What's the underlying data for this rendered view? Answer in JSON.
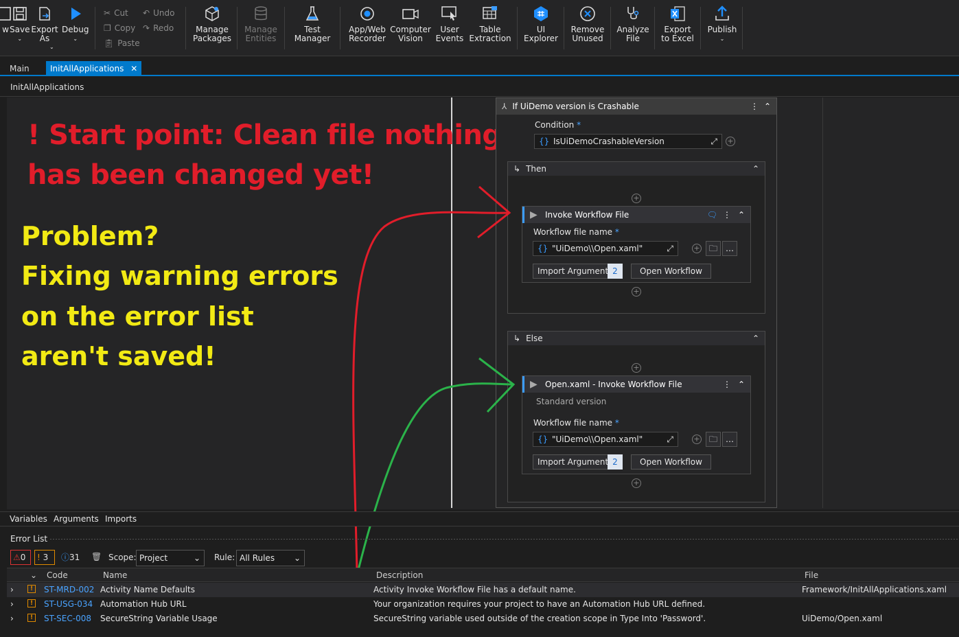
{
  "ribbon": {
    "save_label": "Save",
    "export_as_label": "Export\nAs",
    "debug_label": "Debug",
    "cut_label": "Cut",
    "copy_label": "Copy",
    "paste_label": "Paste",
    "undo_label": "Undo",
    "redo_label": "Redo",
    "manage_packages_label": "Manage\nPackages",
    "manage_entities_label": "Manage\nEntities",
    "test_manager_label": "Test\nManager",
    "app_web_recorder_label": "App/Web\nRecorder",
    "computer_vision_label": "Computer\nVision",
    "user_events_label": "User\nEvents",
    "table_extraction_label": "Table\nExtraction",
    "ui_explorer_label": "UI\nExplorer",
    "remove_unused_label": "Remove\nUnused",
    "analyze_file_label": "Analyze\nFile",
    "export_excel_label": "Export\nto Excel",
    "publish_label": "Publish"
  },
  "tabs": [
    {
      "label": "Main"
    },
    {
      "label": "InitAllApplications"
    }
  ],
  "breadcrumb": "InitAllApplications",
  "annotations": {
    "red_line1": "! Start point: Clean file nothing",
    "red_line2": "has been changed yet!",
    "yellow_line1": "Problem?",
    "yellow_line2": "Fixing warning errors",
    "yellow_line3": "on the error list",
    "yellow_line4": "aren't saved!"
  },
  "if_activity": {
    "title": "If UiDemo version is Crashable",
    "condition_label": "Condition",
    "condition_value": "IsUiDemoCrashableVersion",
    "then_label": "Then",
    "else_label": "Else",
    "then_invoke": {
      "title": "Invoke Workflow File",
      "file_label": "Workflow file name",
      "file_value": "\"UiDemo\\\\Open.xaml\"",
      "import_label": "Import Arguments",
      "import_count": "2",
      "open_label": "Open Workflow"
    },
    "else_invoke": {
      "title": "Open.xaml - Invoke Workflow File",
      "subtitle": "Standard version",
      "file_label": "Workflow file name",
      "file_value": "\"UiDemo\\\\Open.xaml\"",
      "import_label": "Import Arguments",
      "import_count": "2",
      "open_label": "Open Workflow"
    }
  },
  "bottom_tabs": [
    "Variables",
    "Arguments",
    "Imports"
  ],
  "error_list": {
    "title": "Error List",
    "errors_count": "0",
    "warnings_count": "3",
    "info_count": "31",
    "scope_label": "Scope:",
    "scope_value": "Project",
    "rule_label": "Rule:",
    "rule_value": "All Rules",
    "columns": [
      "Code",
      "Name",
      "Description",
      "File"
    ],
    "rows": [
      {
        "code": "ST-MRD-002",
        "name": "Activity Name Defaults",
        "description": "Activity Invoke Workflow File has a default name.",
        "file": "Framework/InitAllApplications.xaml"
      },
      {
        "code": "ST-USG-034",
        "name": "Automation Hub URL",
        "description": "Your organization requires your project to have an Automation Hub URL defined.",
        "file": ""
      },
      {
        "code": "ST-SEC-008",
        "name": "SecureString Variable Usage",
        "description": "SecureString variable used outside of the creation scope in Type Into 'Password'.",
        "file": "UiDemo/Open.xaml"
      }
    ]
  },
  "colors": {
    "accent": "#007acc",
    "annotation_red": "#e11d2a",
    "annotation_yellow": "#f2ea14",
    "arrow_green": "#2bb34a"
  }
}
